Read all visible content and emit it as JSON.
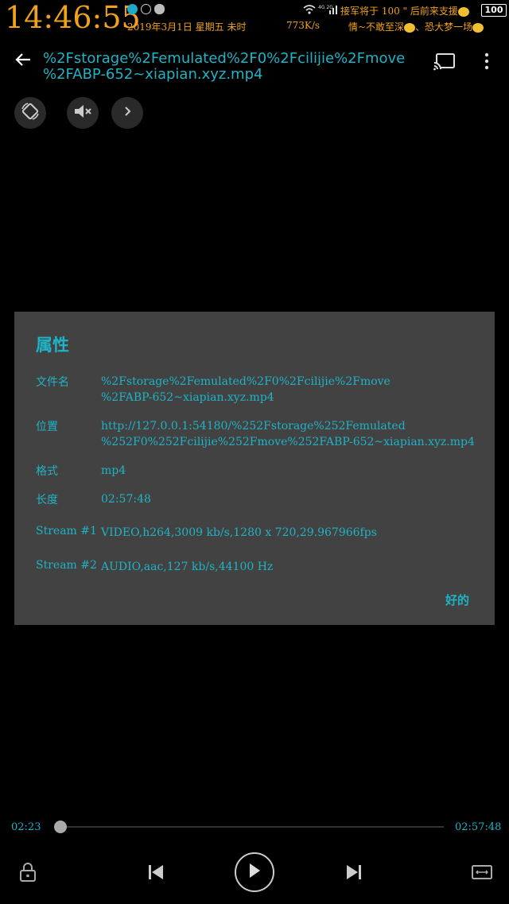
{
  "status_bar": {
    "time": "14:46:55",
    "date": "2019年3月1日 星期五 未时",
    "net_speed": "773K/s",
    "wifi_label": "4G 2G",
    "motto_line1": "接军将于 100 \" 后前来支援",
    "motto_line2": "情~不敢至深",
    "motto_line3": "恐大梦一场",
    "battery": "100"
  },
  "header": {
    "title": "%2Fstorage%2Femulated%2F0%2Fcilijie%2Fmove%2FABP-652~xiapian.xyz.mp4",
    "title_line1": "%2Fstorage%2Femulated%2F0%2Fcilijie%2Fmove",
    "title_line2": "%2FABP-652~xiapian.xyz.mp4"
  },
  "dialog": {
    "title": "属性",
    "filename_label": "文件名",
    "filename_line1": "%2Fstorage%2Femulated%2F0%2Fcilijie%2Fmove",
    "filename_line2": "%2FABP-652~xiapian.xyz.mp4",
    "location_label": "位置",
    "location_line1": "http://127.0.0.1:54180/%252Fstorage%252Femulated",
    "location_line2": "%252F0%252Fcilijie%252Fmove%252FABP-652~xiapian.xyz.mp4",
    "format_label": "格式",
    "format_value": "mp4",
    "duration_label": "长度",
    "duration_value": "02:57:48",
    "stream1_label": "Stream #1",
    "stream1_value": "VIDEO,h264,3009 kb/s,1280 x 720,29.967966fps",
    "stream2_label": "Stream #2",
    "stream2_value": "AUDIO,aac,127 kb/s,44100 Hz",
    "ok_label": "好的"
  },
  "player": {
    "current_time": "02:23",
    "total_time": "02:57:48",
    "progress_fraction": 0.013
  },
  "icons": {
    "back": "back-arrow-icon",
    "cast": "cast-icon",
    "more": "more-vert-icon",
    "rotate": "screen-rotation-icon",
    "mute": "volume-mute-icon",
    "expand": "chevron-right-icon",
    "lock": "lock-icon",
    "prev": "skip-previous-icon",
    "play": "play-icon",
    "next": "skip-next-icon",
    "aspect": "aspect-ratio-icon"
  },
  "colors": {
    "accent": "#1fb3c6",
    "status_text": "#f0a21a",
    "dialog_bg": "#424242"
  }
}
